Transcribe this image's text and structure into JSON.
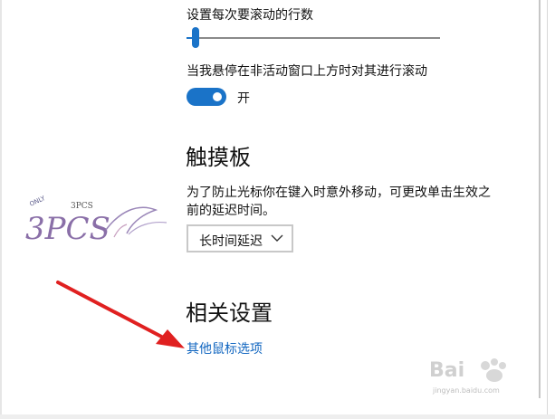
{
  "mouse": {
    "scroll_lines_label": "设置每次要滚动的行数",
    "scroll_lines_value": 0.02,
    "hover_scroll_label": "当我悬停在非活动窗口上方时对其进行滚动",
    "hover_scroll_on": true,
    "hover_scroll_state": "开"
  },
  "touchpad": {
    "title": "触摸板",
    "description_line1": "为了防止光标你在键入时意外移动，可更改单击生效之",
    "description_line2": "前的延迟时间。",
    "delay_selected": "长时间延迟"
  },
  "related": {
    "title": "相关设置",
    "other_mouse_options": "其他鼠标选项"
  },
  "watermarks": {
    "logo_text_top": "ONLY",
    "logo_text_pcs": "3PCS",
    "logo_text_main": "3PCS",
    "baidu_text": "Bai",
    "baidu_sub": "jingyan.baidu.com"
  },
  "colors": {
    "accent": "#1a73c8",
    "link": "#1166c0",
    "arrow": "#e02020"
  }
}
